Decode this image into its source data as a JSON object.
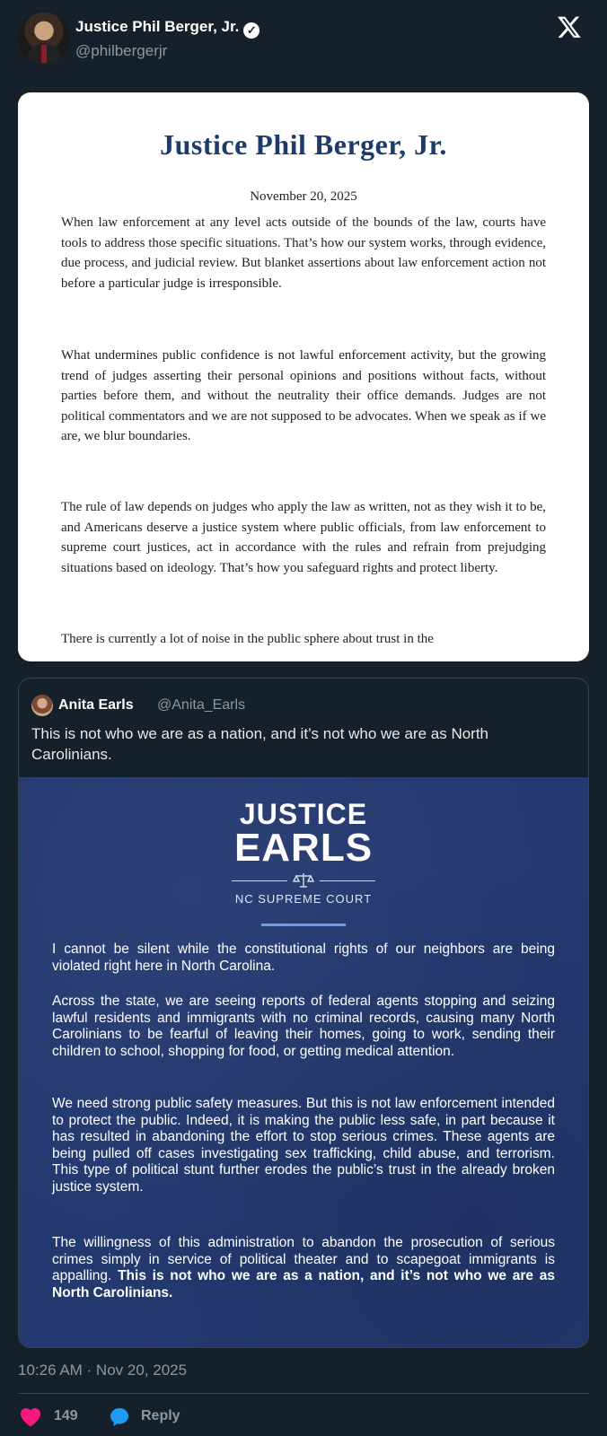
{
  "tweet": {
    "author_name": "Justice Phil Berger, Jr.",
    "author_handle": "@philbergerjr",
    "timestamp": "10:26 AM · Nov 20, 2025",
    "likes": "149",
    "reply_label": "Reply"
  },
  "letter": {
    "title": "Justice Phil Berger, Jr.",
    "date": "November 20, 2025",
    "paragraphs": [
      "When law enforcement at any level acts outside of the bounds of the law, courts have tools to address those specific situations. That’s how our system works, through evidence, due process, and judicial review. But blanket assertions about law enforcement action not before a particular judge is irresponsible.",
      "What undermines public confidence is not lawful enforcement activity, but the growing trend of judges asserting their personal opinions and positions without facts, without parties before them, and without the neutrality their office demands. Judges are not political commentators and we are not supposed to be advocates. When we speak as if we are, we blur boundaries.",
      "The rule of law depends on judges who apply the law as written, not as they wish it to be, and Americans deserve a justice system where public officials, from law enforcement to supreme court justices, act in accordance with the rules and refrain from prejudging situations based on ideology. That’s how you safeguard rights and protect liberty.",
      "There is currently a lot of noise in the public sphere about trust in the"
    ]
  },
  "quote": {
    "author_name": "Anita Earls",
    "author_handle": "@Anita_Earls",
    "text": "This is not who we are as a nation, and it’s not who we are as North Carolinians.",
    "image": {
      "logo_line1": "JUSTICE",
      "logo_line2": "EARLS",
      "logo_sub": "NC SUPREME COURT",
      "paragraphs": [
        "I cannot be silent while the constitutional rights of our neighbors are being violated right here in North Carolina.",
        "Across the state, we are seeing reports of federal agents stopping and seizing lawful residents and immigrants with no criminal records, causing many North Carolinians to be fearful of leaving their homes, going to work, sending their children to school, shopping for food, or getting medical attention.",
        "We need strong public safety measures. But this is not law enforcement intended to protect the public. Indeed, it is making the public less safe, in part because it has resulted in abandoning the effort to stop serious crimes. These agents are being pulled off cases investigating sex trafficking, child abuse, and terrorism. This type of political stunt further erodes the public’s trust in the already broken justice system.",
        "The willingness of this administration to abandon the prosecution of serious crimes simply in service of political theater and to scapegoat immigrants is appalling."
      ],
      "bold_ending": "This is not who we are as a nation, and it’s not who we are as North Carolinians."
    }
  },
  "colors": {
    "background": "#15202b",
    "letter_title": "#1f3b6e",
    "quote_image_bg": "#243970",
    "like": "#f91880",
    "reply": "#1d9bf0"
  },
  "icons": [
    "verified-badge-icon",
    "x-logo-icon",
    "heart-icon",
    "reply-bubble-icon"
  ]
}
